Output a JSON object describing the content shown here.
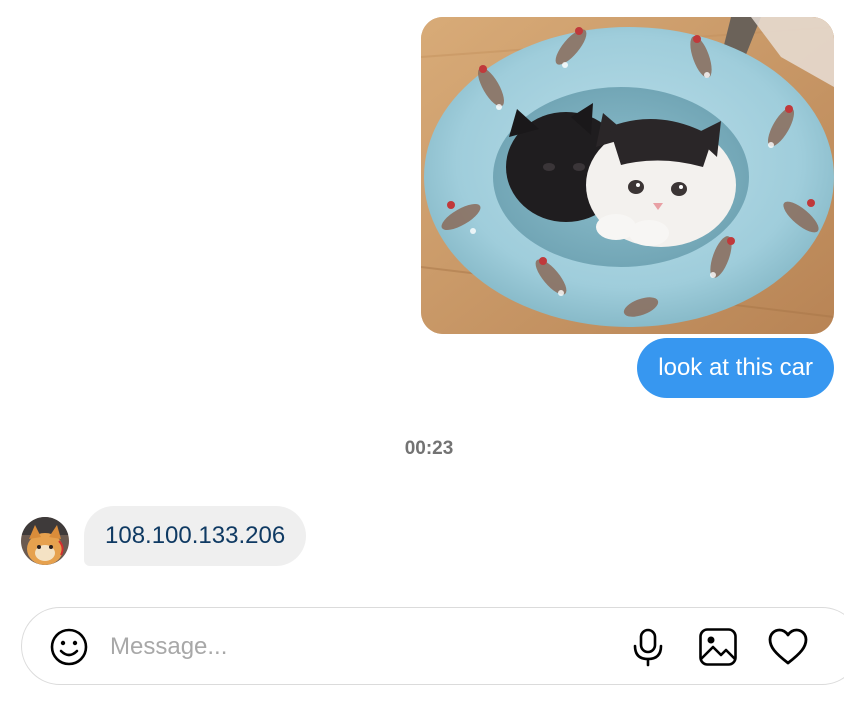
{
  "messages": {
    "sent_photo": {
      "alt": "kittens in a pet bed"
    },
    "sent_text": "look at this car",
    "timestamp": "00:23",
    "received_text": "108.100.133.206"
  },
  "composer": {
    "placeholder": "Message...",
    "value": ""
  },
  "icons": {
    "emoji": "smiley-icon",
    "mic": "microphone-icon",
    "image": "image-icon",
    "like": "heart-icon"
  },
  "colors": {
    "sent_bubble": "#3797f0",
    "received_bubble": "#efefef",
    "timestamp": "#737373",
    "placeholder": "#a8a8a8"
  }
}
